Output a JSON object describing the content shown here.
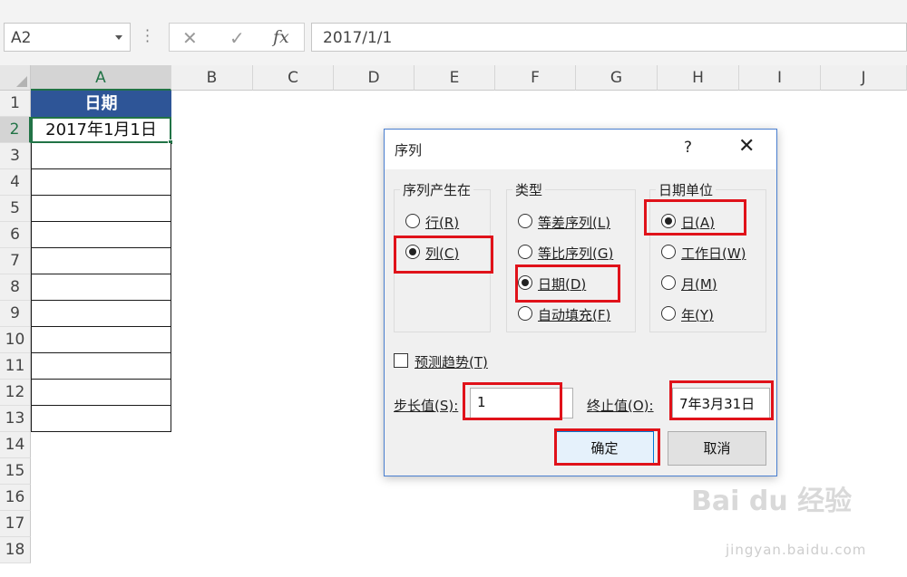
{
  "formula_bar": {
    "name_box": "A2",
    "cancel_glyph": "✕",
    "enter_glyph": "✓",
    "fx_label": "fx",
    "formula_value": "2017/1/1"
  },
  "columns": [
    "A",
    "B",
    "C",
    "D",
    "E",
    "F",
    "G",
    "H",
    "I",
    "J"
  ],
  "rows": [
    "1",
    "2",
    "3",
    "4",
    "5",
    "6",
    "7",
    "8",
    "9",
    "10",
    "11",
    "12",
    "13",
    "14",
    "15",
    "16",
    "17",
    "18"
  ],
  "cells": {
    "A1": "日期",
    "A2": "2017年1月1日"
  },
  "dialog": {
    "title": "序列",
    "help": "?",
    "close": "✕",
    "group_series_in": {
      "label": "序列产生在",
      "options": [
        {
          "text": "行(R)",
          "selected": false
        },
        {
          "text": "列(C)",
          "selected": true
        }
      ]
    },
    "group_type": {
      "label": "类型",
      "options": [
        {
          "text": "等差序列(L)",
          "selected": false
        },
        {
          "text": "等比序列(G)",
          "selected": false
        },
        {
          "text": "日期(D)",
          "selected": true
        },
        {
          "text": "自动填充(F)",
          "selected": false
        }
      ]
    },
    "group_date_unit": {
      "label": "日期单位",
      "options": [
        {
          "text": "日(A)",
          "selected": true
        },
        {
          "text": "工作日(W)",
          "selected": false
        },
        {
          "text": "月(M)",
          "selected": false
        },
        {
          "text": "年(Y)",
          "selected": false
        }
      ]
    },
    "trend_label": "预测趋势(T)",
    "trend_checked": false,
    "step_label": "步长值(S):",
    "step_value": "1",
    "stop_label": "终止值(O):",
    "stop_value": "7年3月31日",
    "ok_label": "确定",
    "cancel_label": "取消"
  },
  "watermark": {
    "brand": "Bai du 经验",
    "url": "jingyan.baidu.com"
  },
  "colors": {
    "header_fill": "#2e5597",
    "excel_green": "#217346",
    "highlight_red": "#e0121a"
  }
}
